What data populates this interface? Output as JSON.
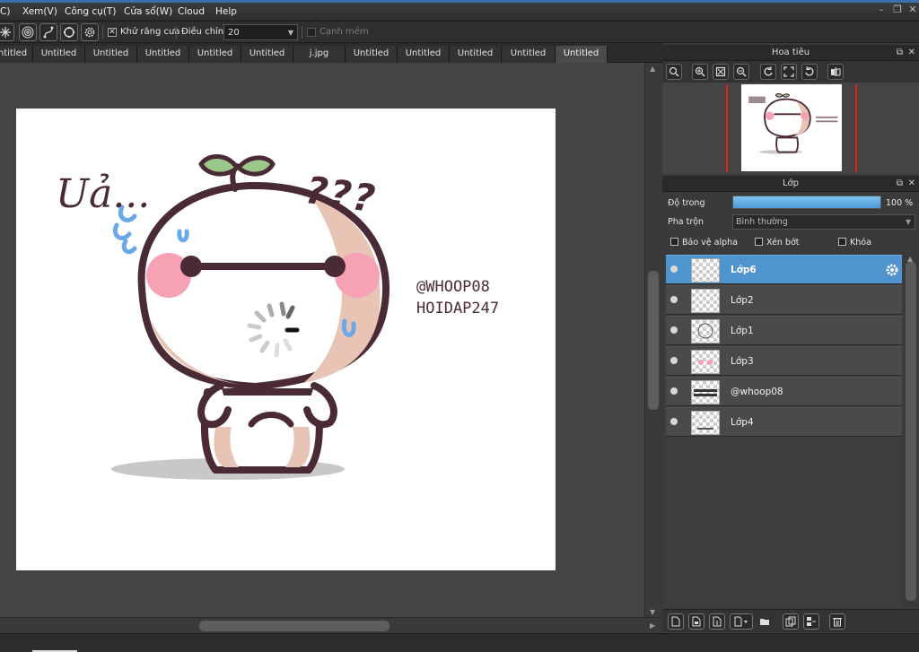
{
  "menu": {
    "items": [
      "C)",
      "Xem(V)",
      "Công cụ(T)",
      "Cửa sổ(W)",
      "Cloud",
      "Help"
    ]
  },
  "toolbar": {
    "antialias_label": "Khử răng cưa",
    "adjust_label": "Điều chỉnh",
    "adjust_value": "20",
    "soft_edge_label": "Cạnh mềm"
  },
  "tabs": [
    "ntitled",
    "Untitled",
    "Untitled",
    "Untitled",
    "Untitled",
    "Untitled",
    "j.jpg",
    "Untitled",
    "Untitled",
    "Untitled",
    "Untitled",
    "Untitled"
  ],
  "active_tab_index": 11,
  "artwork": {
    "exclaim": "Uả...",
    "question": "???",
    "handle": "@WHOOP08",
    "site": "HOIDAP247"
  },
  "navigator": {
    "title": "Hoa tiêu"
  },
  "layers_panel": {
    "title": "Lớp",
    "opacity_label": "Độ trong",
    "opacity_value": "100 %",
    "opacity_fraction": 1.0,
    "blend_label": "Pha trộn",
    "blend_value": "Bình thường",
    "protect_alpha": "Bảo vệ alpha",
    "clip": "Xén bớt",
    "lock": "Khóa",
    "layers": [
      {
        "name": "Lớp6",
        "selected": true
      },
      {
        "name": "Lớp2",
        "selected": false
      },
      {
        "name": "Lớp1",
        "selected": false
      },
      {
        "name": "Lớp3",
        "selected": false
      },
      {
        "name": "@whoop08",
        "selected": false
      },
      {
        "name": "Lớp4",
        "selected": false
      }
    ]
  },
  "colors": {
    "accent": "#4f94cf",
    "canvas_bg": "#444444",
    "outline": "#4a2a35",
    "blush": "#f7a1b5",
    "skin": "#e8c4b4",
    "leaf": "#9ac88a",
    "sweat": "#6aa8e8"
  }
}
